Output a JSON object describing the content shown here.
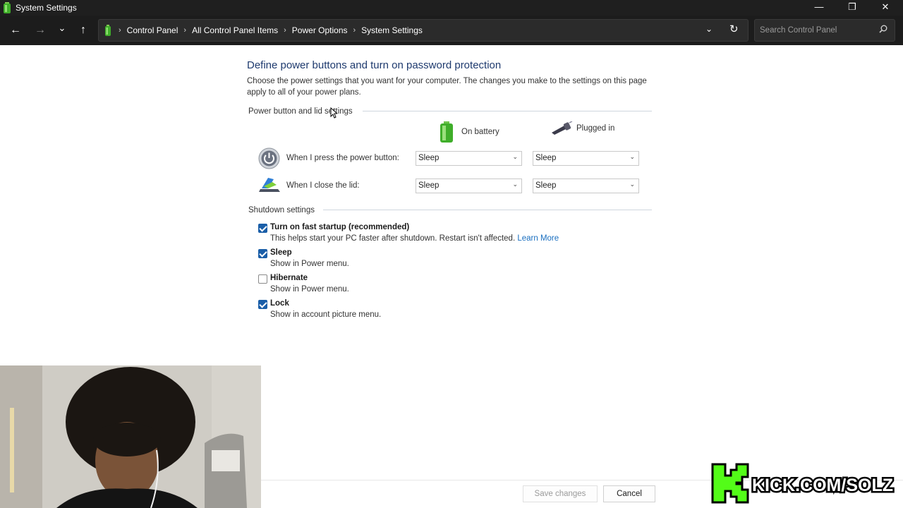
{
  "window": {
    "title": "System Settings",
    "minimize_glyph": "—",
    "restore_glyph": "❐",
    "close_glyph": "✕"
  },
  "nav": {
    "back_glyph": "←",
    "forward_glyph": "→",
    "recent_glyph": "⌄",
    "up_glyph": "↑"
  },
  "breadcrumb": [
    "Control Panel",
    "All Control Panel Items",
    "Power Options",
    "System Settings"
  ],
  "breadcrumb_sep": "›",
  "address": {
    "dropdown_glyph": "⌄",
    "refresh_glyph": "↻"
  },
  "search": {
    "placeholder": "Search Control Panel",
    "icon": "search-icon"
  },
  "main": {
    "heading": "Define power buttons and turn on password protection",
    "description": "Choose the power settings that you want for your computer. The changes you make to the settings on this page apply to all of your power plans.",
    "power_section": "Power button and lid settings",
    "columns": {
      "battery": "On battery",
      "plugged": "Plugged in"
    },
    "rows": [
      {
        "label": "When I press the power button:",
        "battery": "Sleep",
        "plugged": "Sleep",
        "icon": "power-button-icon"
      },
      {
        "label": "When I close the lid:",
        "battery": "Sleep",
        "plugged": "Sleep",
        "icon": "laptop-lid-icon"
      }
    ],
    "shutdown_section": "Shutdown settings",
    "options": [
      {
        "label": "Turn on fast startup (recommended)",
        "sub": "This helps start your PC faster after shutdown. Restart isn't affected.",
        "link": "Learn More",
        "checked": true
      },
      {
        "label": "Sleep",
        "sub": "Show in Power menu.",
        "checked": true
      },
      {
        "label": "Hibernate",
        "sub": "Show in Power menu.",
        "checked": false
      },
      {
        "label": "Lock",
        "sub": "Show in account picture menu.",
        "checked": true
      }
    ]
  },
  "footer": {
    "save": "Save changes",
    "cancel": "Cancel"
  },
  "overlay": {
    "kick_text": "KICK.COM/SOLZ"
  },
  "colors": {
    "accent": "#1a5ea8",
    "heading": "#1e3a6e",
    "link": "#1a6fc0",
    "kick_green": "#53fc18"
  },
  "select_arrow": "⌄"
}
